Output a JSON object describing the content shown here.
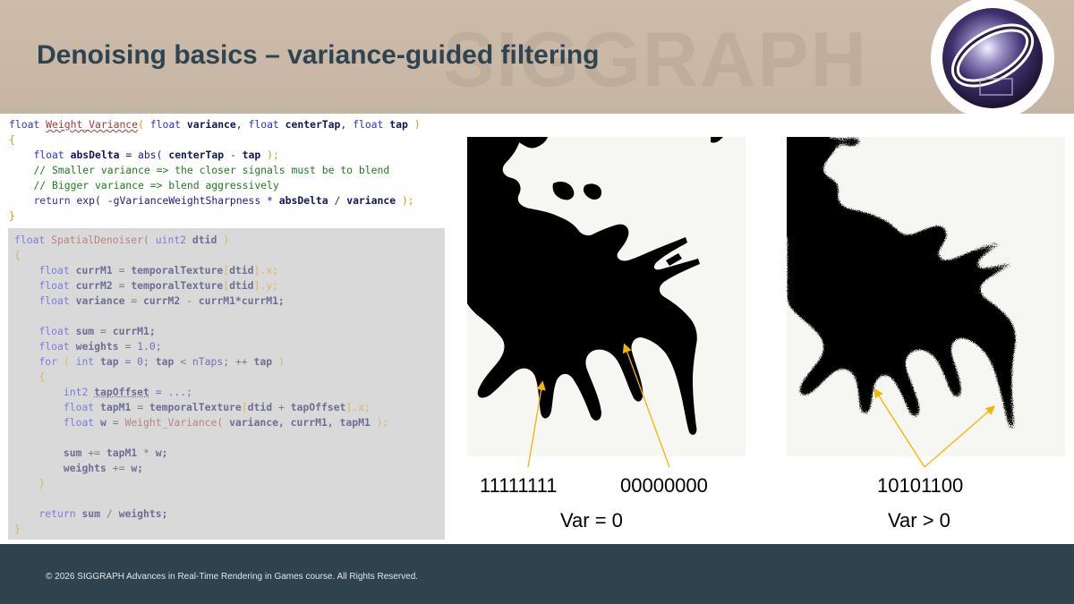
{
  "slide": {
    "title": "Denoising basics – variance-guided filtering",
    "watermark_text": "SIGGRAPH",
    "footer_text": "© 2026 SIGGRAPH Advances in Real-Time Rendering in Games course. All Rights Reserved."
  },
  "figures": {
    "left": {
      "label_a": "11111111",
      "label_b": "00000000",
      "caption": "Var = 0"
    },
    "right": {
      "label": "10101100",
      "caption": "Var > 0"
    }
  },
  "colors": {
    "header_bg": "#c9b8a6",
    "title_color": "#2e4450",
    "footer_bg": "#2e434d",
    "annotation_arrow": "#f5b400",
    "code_panel_bg": "#d9d9d9"
  },
  "code": {
    "weight_variance": {
      "l1": {
        "t1": "float",
        "t2": "Weight_Variance",
        "t3": "(",
        "t4": "float",
        "t5": "variance",
        "t6": ",",
        "t7": "float",
        "t8": "centerTap",
        "t9": ",",
        "t10": "float",
        "t11": "tap",
        "t12": ")"
      },
      "l2": {
        "t1": "{"
      },
      "l3": {
        "t1": "float",
        "t2": "absDelta",
        "t3": "= abs(",
        "t4": "centerTap",
        "t5": "-",
        "t6": "tap",
        "t7": ");"
      },
      "l4": {
        "t1": "// Smaller variance => the closer signals must be to blend"
      },
      "l5": {
        "t1": "// Bigger variance => blend aggressively"
      },
      "l6": {
        "t1": "return",
        "t2": "exp( -gVarianceWeightSharpness *",
        "t3": "absDelta",
        "t4": "/",
        "t5": "variance",
        "t6": ");"
      },
      "l7": {
        "t1": "}"
      }
    },
    "spatial_denoiser": {
      "l1": {
        "t1": "float",
        "t2": "SpatialDenoiser(",
        "t3": "uint2",
        "t4": "dtid",
        "t5": ")"
      },
      "l2": {
        "t1": "{"
      },
      "l3": {
        "t1": "float",
        "t2": "currM1",
        "t3": "=",
        "t4": "temporalTexture",
        "t5": "[",
        "t6": "dtid",
        "t7": "].x;"
      },
      "l4": {
        "t1": "float",
        "t2": "currM2",
        "t3": "=",
        "t4": "temporalTexture",
        "t5": "[",
        "t6": "dtid",
        "t7": "].y;"
      },
      "l5": {
        "t1": "float",
        "t2": "variance",
        "t3": "=",
        "t4": "currM2",
        "t5": "-",
        "t6": "currM1*currM1;"
      },
      "l6": {
        "t1": "float",
        "t2": "sum",
        "t3": "=",
        "t4": "currM1;"
      },
      "l7": {
        "t1": "float",
        "t2": "weights",
        "t3": "=",
        "t4": "1.0;"
      },
      "l8": {
        "t1": "for",
        "t2": "(",
        "t3": "int",
        "t4": "tap",
        "t5": "= 0;",
        "t6": "tap",
        "t7": "<",
        "t8": "nTaps;",
        "t9": "++",
        "t10": "tap",
        "t11": ")"
      },
      "l9": {
        "t1": "{"
      },
      "l10": {
        "t1": "int2",
        "t2": "tapOffset",
        "t3": "= ...;"
      },
      "l11": {
        "t1": "float",
        "t2": "tapM1",
        "t3": "=",
        "t4": "temporalTexture",
        "t5": "[",
        "t6": "dtid",
        "t7": "+",
        "t8": "tapOffset",
        "t9": "].x;"
      },
      "l12": {
        "t1": "float",
        "t2": "w",
        "t3": "=",
        "t4": "Weight_Variance(",
        "t5": "variance,",
        "t6": "currM1,",
        "t7": "tapM1",
        "t8": ");"
      },
      "l13": {
        "t1": "sum",
        "t2": "+=",
        "t3": "tapM1",
        "t4": "*",
        "t5": "w;"
      },
      "l14": {
        "t1": "weights",
        "t2": "+=",
        "t3": "w;"
      },
      "l15": {
        "t1": "}"
      },
      "l16": {
        "t1": "return",
        "t2": "sum",
        "t3": "/",
        "t4": "weights;"
      },
      "l17": {
        "t1": "}"
      }
    }
  }
}
